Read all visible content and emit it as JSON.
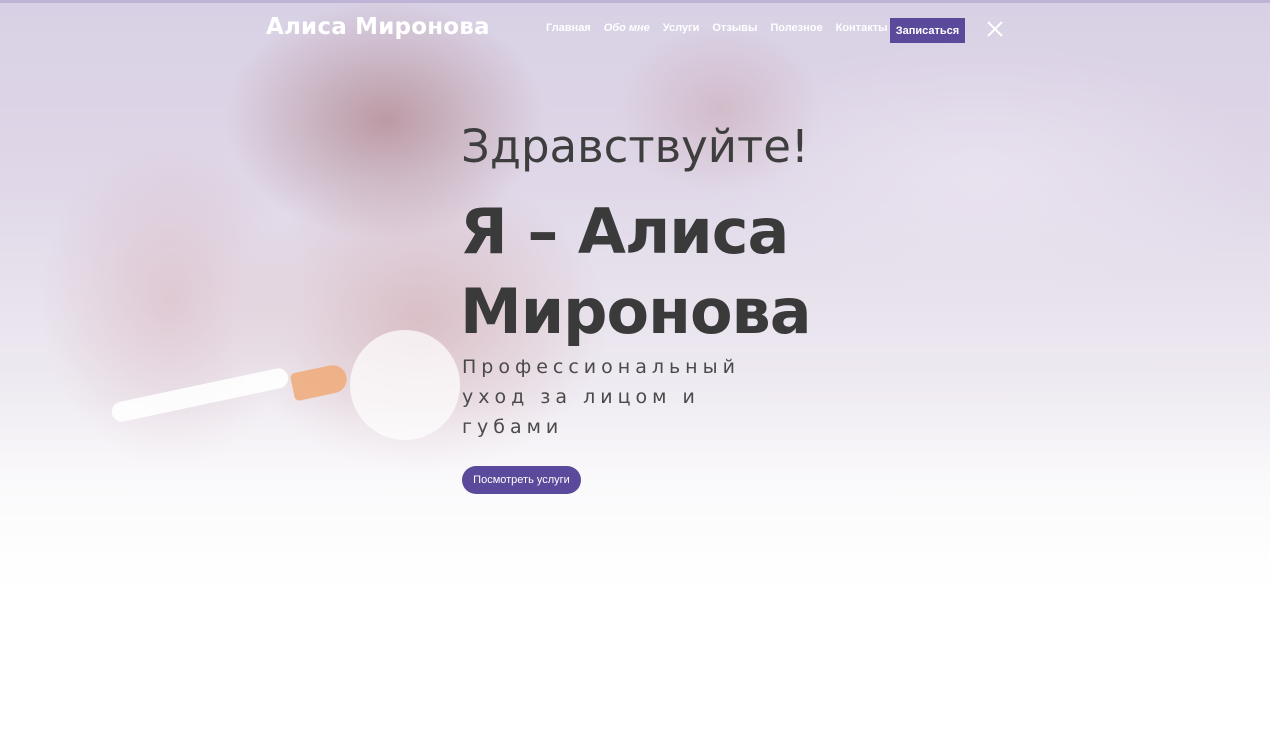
{
  "header": {
    "logo": "Алиса Миронова",
    "nav": [
      {
        "label": "Главная",
        "italic": false
      },
      {
        "label": "Обо мне",
        "italic": true
      },
      {
        "label": "Услуги",
        "italic": false
      },
      {
        "label": "Отзывы",
        "italic": false
      },
      {
        "label": "Полезное",
        "italic": false
      },
      {
        "label": "Контакты",
        "italic": false
      }
    ],
    "cta_label": "Записаться",
    "close_icon": "close-icon"
  },
  "hero": {
    "greeting": "Здравствуйте!",
    "title": "Я – Алиса Миронова",
    "subtitle": "Профессиональный уход за лицом и губами",
    "button_label": "Посмотреть услуги"
  },
  "colors": {
    "accent": "#5b4a9c",
    "heading": "#3a3a3a",
    "nav_text": "#ffffff"
  }
}
